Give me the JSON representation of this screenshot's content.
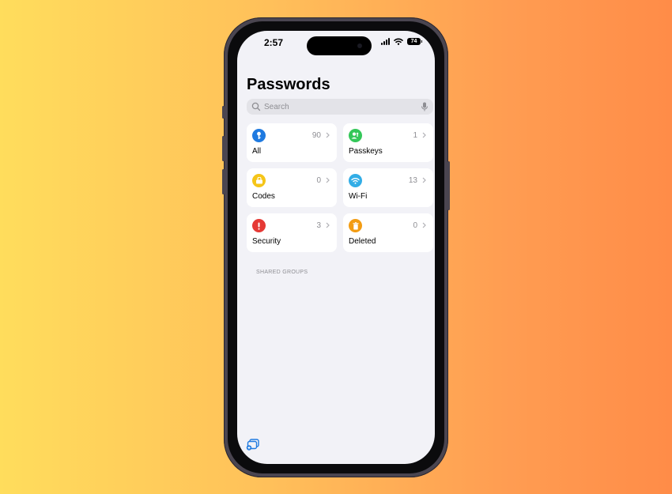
{
  "status_bar": {
    "time": "2:57",
    "battery": "74"
  },
  "header": {
    "title": "Passwords"
  },
  "search": {
    "placeholder": "Search"
  },
  "categories": [
    {
      "label": "All",
      "count": "90",
      "color": "#1f7ae0",
      "icon": "key-icon"
    },
    {
      "label": "Passkeys",
      "count": "1",
      "color": "#34c759",
      "icon": "person-badge-icon"
    },
    {
      "label": "Codes",
      "count": "0",
      "color": "#f5c518",
      "icon": "lock-code-icon"
    },
    {
      "label": "Wi-Fi",
      "count": "13",
      "color": "#32ade6",
      "icon": "wifi-icon"
    },
    {
      "label": "Security",
      "count": "3",
      "color": "#e53935",
      "icon": "exclamation-icon"
    },
    {
      "label": "Deleted",
      "count": "0",
      "color": "#f39c12",
      "icon": "trash-icon"
    }
  ],
  "sections": {
    "shared_groups": "SHARED GROUPS"
  },
  "toolbar": {
    "icon": "new-group-icon",
    "accent": "#1f7ae0"
  }
}
